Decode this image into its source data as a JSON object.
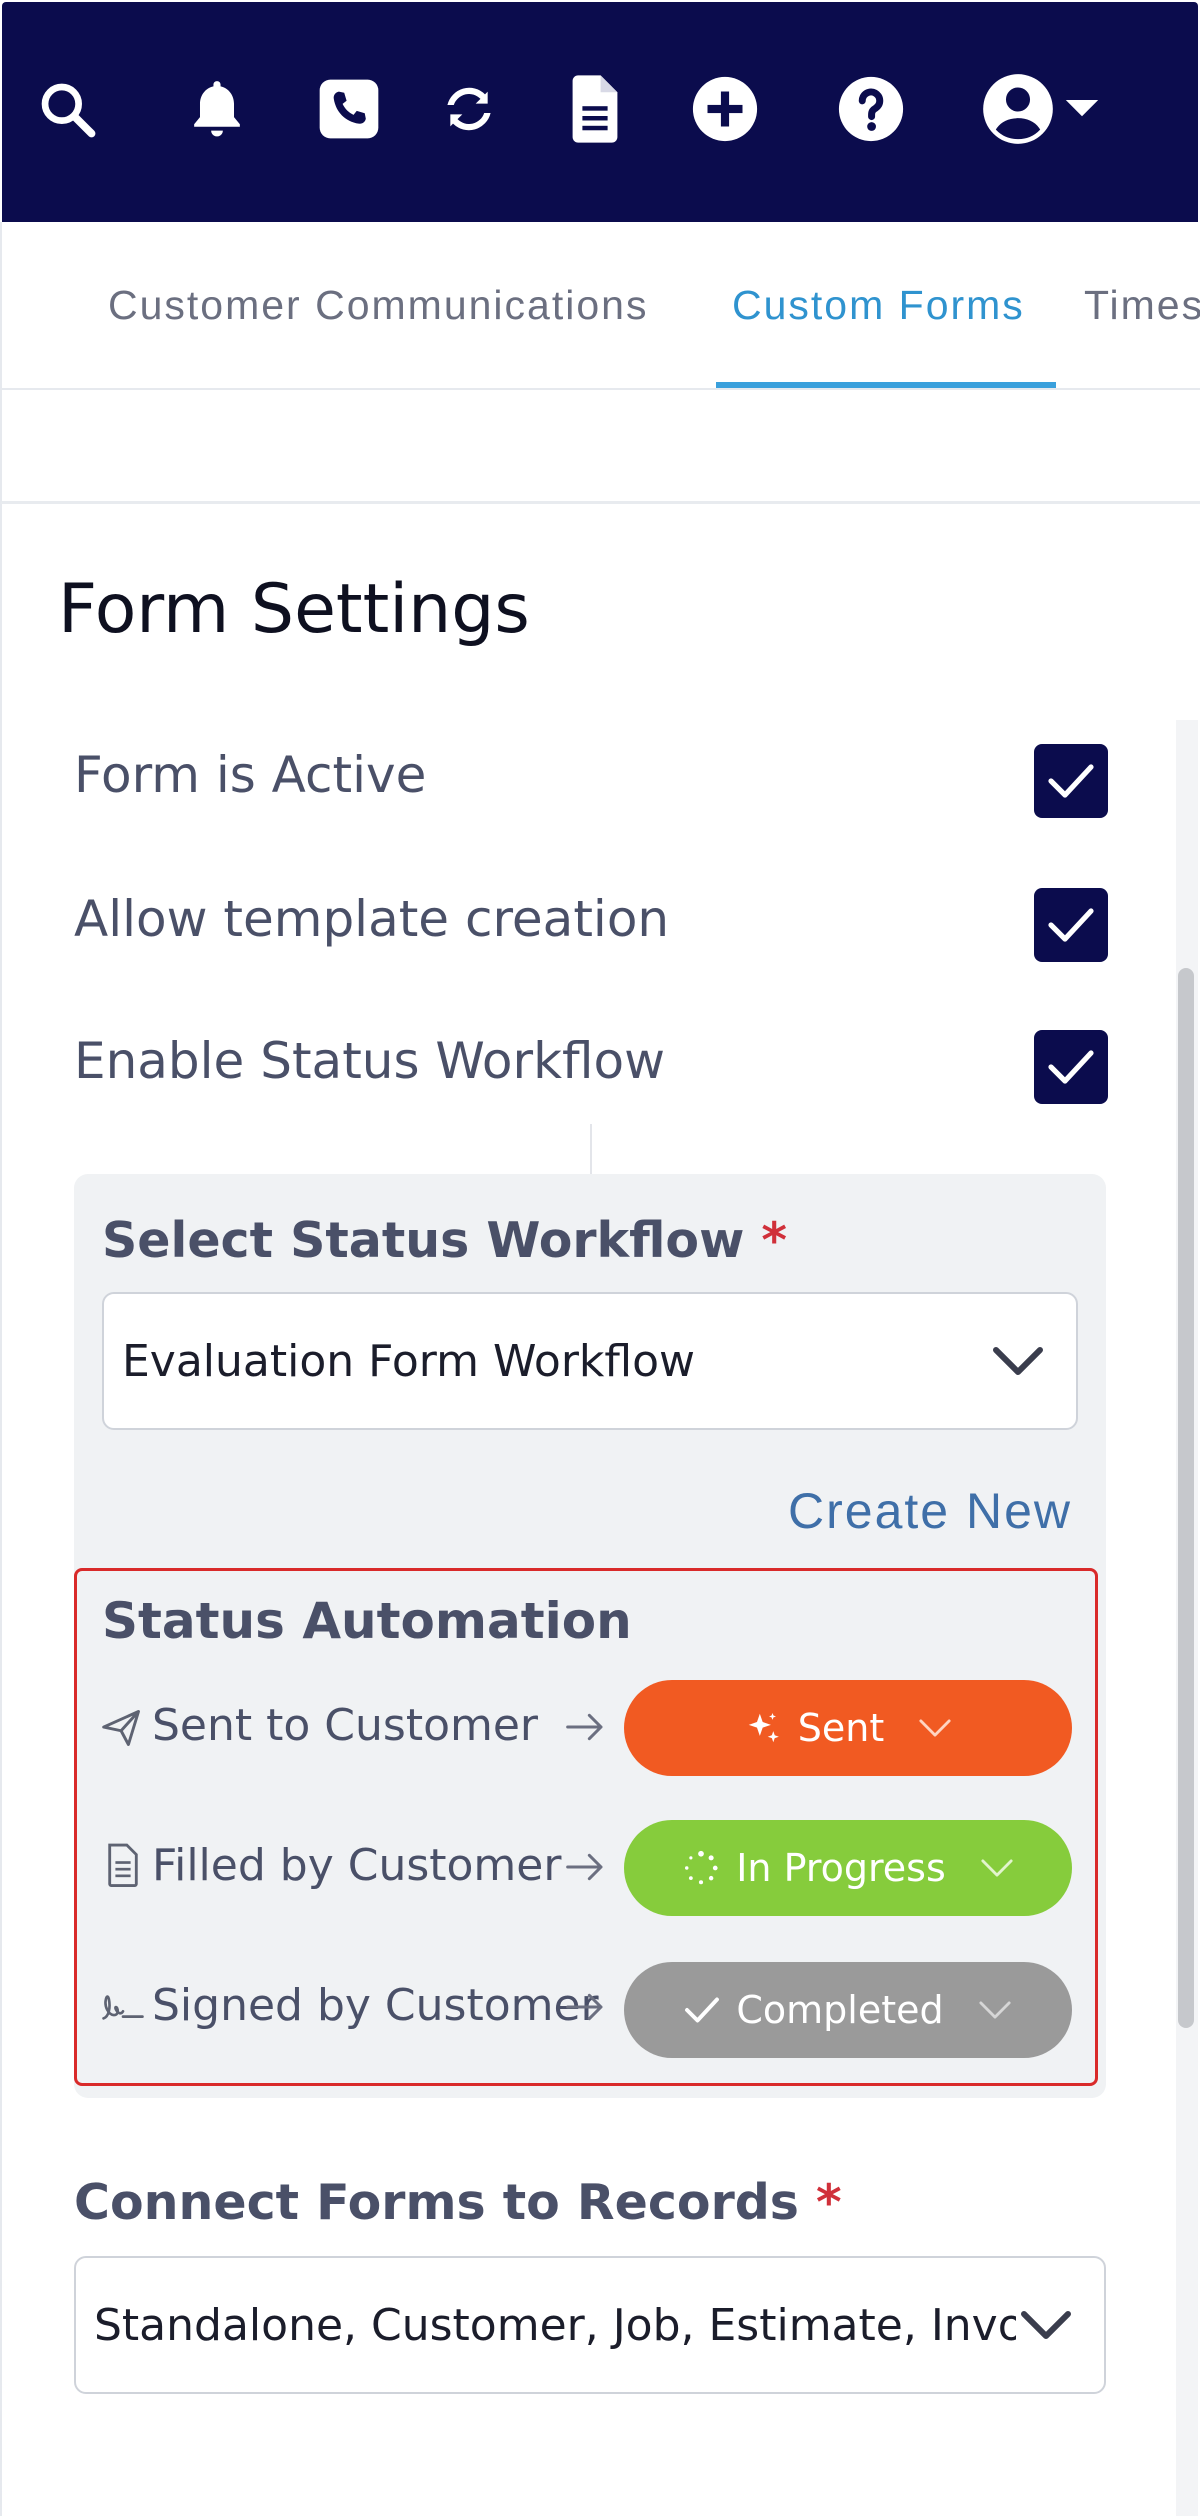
{
  "topbar": {
    "icons": [
      "search-icon",
      "bell-icon",
      "phone-icon",
      "sync-icon",
      "document-icon",
      "add-circle-icon",
      "help-icon",
      "user-account-icon"
    ],
    "color": "#0b0c4d"
  },
  "tabs": [
    {
      "label": "Customer Communications",
      "active": false
    },
    {
      "label": "Custom Forms",
      "active": true
    },
    {
      "label": "Times",
      "active": false
    }
  ],
  "page": {
    "title": "Form Settings"
  },
  "settings": [
    {
      "label": "Form is Active",
      "checked": true
    },
    {
      "label": "Allow template creation",
      "checked": true
    },
    {
      "label": "Enable Status Workflow",
      "checked": true
    }
  ],
  "workflow": {
    "label": "Select Status Workflow",
    "required_mark": "*",
    "selected": "Evaluation Form Workflow",
    "create_new": "Create New"
  },
  "automation": {
    "title": "Status Automation",
    "rows": [
      {
        "label": "Sent to Customer",
        "icon": "paper-plane-icon",
        "status": "Sent",
        "status_icon": "sparkle-icon",
        "color": "#f15a22"
      },
      {
        "label": "Filled by Customer",
        "icon": "document-icon",
        "status": "In Progress",
        "status_icon": "spinner-icon",
        "color": "#86cc3c"
      },
      {
        "label": "Signed by Customer",
        "icon": "signature-icon",
        "status": "Completed",
        "status_icon": "check-icon",
        "color": "#9a9a9a"
      }
    ]
  },
  "records": {
    "label": "Connect Forms to Records",
    "required_mark": "*",
    "selected": "Standalone, Customer, Job, Estimate, Invoice"
  }
}
